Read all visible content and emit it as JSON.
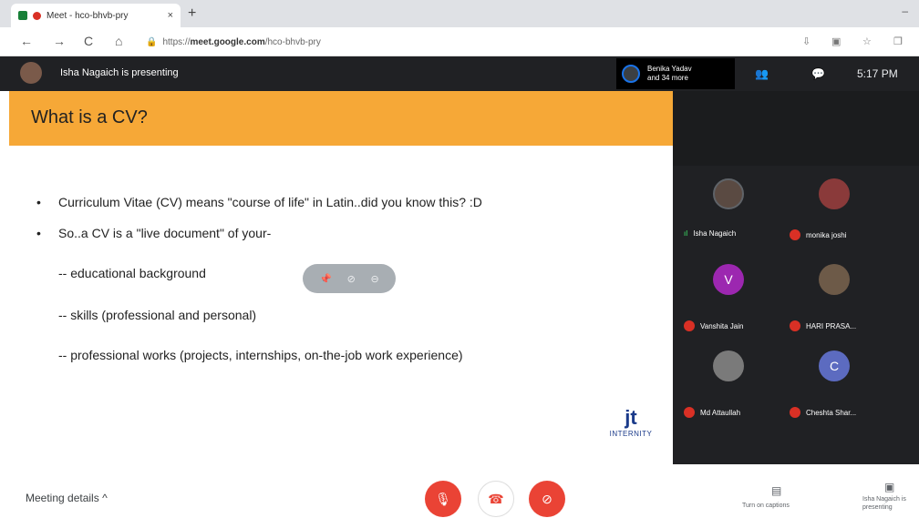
{
  "browser": {
    "tab_title": "Meet - hco-bhvb-pry",
    "tab_close": "×",
    "new_tab": "+",
    "minimize": "–",
    "url_prefix": "https://",
    "url_host": "meet.google.com",
    "url_path": "/hco-bhvb-pry",
    "nav": {
      "back": "←",
      "forward": "→",
      "reload": "C",
      "home": "⌂"
    }
  },
  "meet_bar": {
    "presenting_text": "Isha Nagaich is presenting",
    "speaker_line1": "Benika Yadav",
    "speaker_line2": "and 34 more",
    "people_icon": "people-icon",
    "chat_icon": "chat-icon",
    "time": "5:17 PM"
  },
  "slide": {
    "title": "What is a CV?",
    "bullets": [
      "Curriculum Vitae (CV) means \"course of life\" in Latin..did you know this? :D",
      "So..a CV is a \"live document\" of your-"
    ],
    "sub_items": [
      "-- educational background",
      "-- skills (professional and personal)",
      "-- professional works (projects, internships, on-the-job work experience)"
    ],
    "logo_text": "INTERNITY",
    "logo_mark": "jt",
    "header_color": "#f6a837"
  },
  "participants": [
    {
      "name": "Isha Nagaich",
      "talking": true,
      "initial": "",
      "color": "#5a4a42"
    },
    {
      "name": "monika joshi",
      "talking": false,
      "initial": "",
      "color": "#8a3a3a"
    },
    {
      "name": "Vanshita Jain",
      "talking": false,
      "initial": "V",
      "color": "#9c27b0"
    },
    {
      "name": "HARI PRASA...",
      "talking": false,
      "initial": "",
      "color": "#6d5a48"
    },
    {
      "name": "Md Attaullah",
      "talking": false,
      "initial": "",
      "color": "#7a7a7a"
    },
    {
      "name": "Cheshta Shar...",
      "talking": false,
      "initial": "C",
      "color": "#5c6bc0"
    }
  ],
  "bottom_bar": {
    "meeting_details": "Meeting details",
    "captions_label": "Turn on captions",
    "presenting_label": "Isha Nagaich is presenting"
  },
  "colors": {
    "meet_dark": "#202124",
    "control_red": "#ea4335",
    "accent_blue": "#1a73e8"
  }
}
